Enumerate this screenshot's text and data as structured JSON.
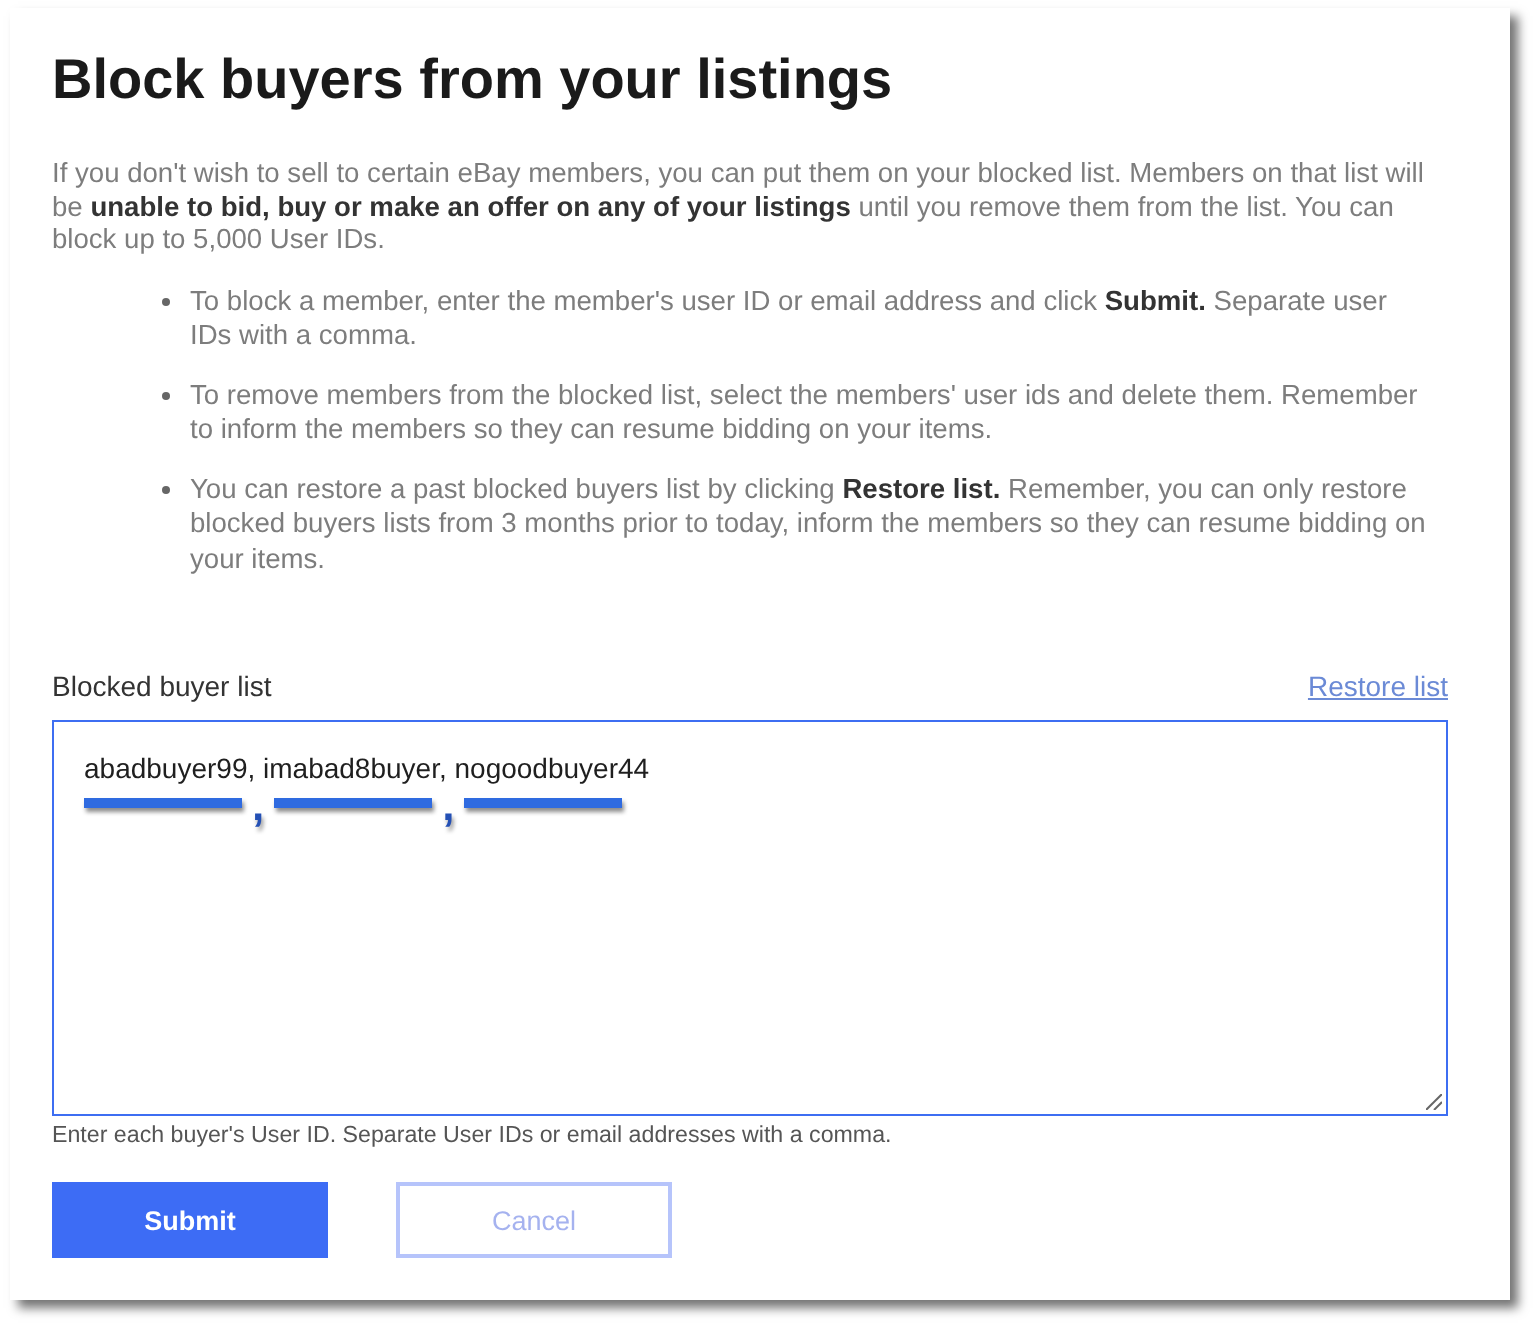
{
  "title": "Block buyers from your listings",
  "intro": "If you don't wish to sell to certain eBay members, you can put them on your blocked list. Members on that list will be **unable to bid, buy or make an offer on any of your listings** until you remove them from the list. You can block up to 5,000 User IDs.",
  "instructions": [
    "To block a member, enter the member's user ID or email address and click **Submit.** Separate user IDs with a comma.",
    "To remove members from the blocked list, select the members' user ids and delete them. Remember to inform the members so they can resume bidding on your items.",
    "You can restore a past blocked buyers list by clicking **Restore list.** Remember, you can only restore blocked buyers lists from 3 months prior to today, inform the members so they can resume bidding on your items."
  ],
  "blocked_list": {
    "label": "Blocked buyer list",
    "restore_link": "Restore list",
    "value": "abadbuyer99, imabad8buyer, nogoodbuyer44",
    "annotation_marks": [
      ",",
      ","
    ],
    "hint": "Enter each buyer's User ID. Separate User IDs or email addresses with a comma."
  },
  "buttons": [
    {
      "label": "Submit",
      "kind": "primary"
    },
    {
      "label": "Cancel",
      "kind": "secondary"
    }
  ]
}
